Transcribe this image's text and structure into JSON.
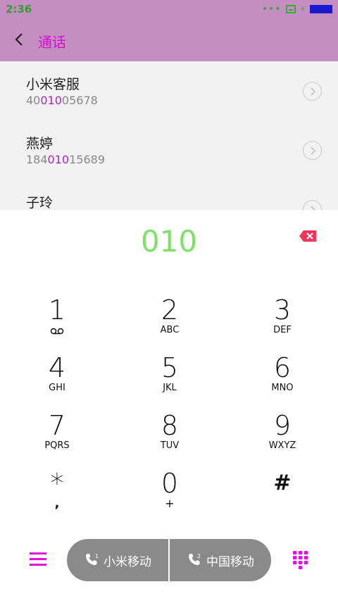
{
  "status": {
    "time": "2:36"
  },
  "header": {
    "title": "通话"
  },
  "results": [
    {
      "name": "小米客服",
      "num_pre": "40",
      "num_hl": "010",
      "num_post": "05678"
    },
    {
      "name": "燕婷",
      "num_pre": "184",
      "num_hl": "010",
      "num_post": "15689"
    },
    {
      "name": "子玲",
      "num_pre": "",
      "num_hl": "",
      "num_post": ""
    }
  ],
  "dial": {
    "input": "010"
  },
  "keys": [
    {
      "digit": "1",
      "letters": ""
    },
    {
      "digit": "2",
      "letters": "ABC"
    },
    {
      "digit": "3",
      "letters": "DEF"
    },
    {
      "digit": "4",
      "letters": "GHI"
    },
    {
      "digit": "5",
      "letters": "JKL"
    },
    {
      "digit": "6",
      "letters": "MNO"
    },
    {
      "digit": "7",
      "letters": "PQRS"
    },
    {
      "digit": "8",
      "letters": "TUV"
    },
    {
      "digit": "9",
      "letters": "WXYZ"
    },
    {
      "digit": "*",
      "letters": ","
    },
    {
      "digit": "0",
      "letters": "+"
    },
    {
      "digit": "#",
      "letters": ""
    }
  ],
  "call": {
    "sim1_label": "小米移动",
    "sim1_index": "1",
    "sim2_label": "中国移动",
    "sim2_index": "2"
  },
  "colors": {
    "accent": "#d010d0",
    "header_bg": "#c48fc0",
    "input": "#7fe06a",
    "highlight": "#b020c8",
    "delete": "#f0365a"
  }
}
